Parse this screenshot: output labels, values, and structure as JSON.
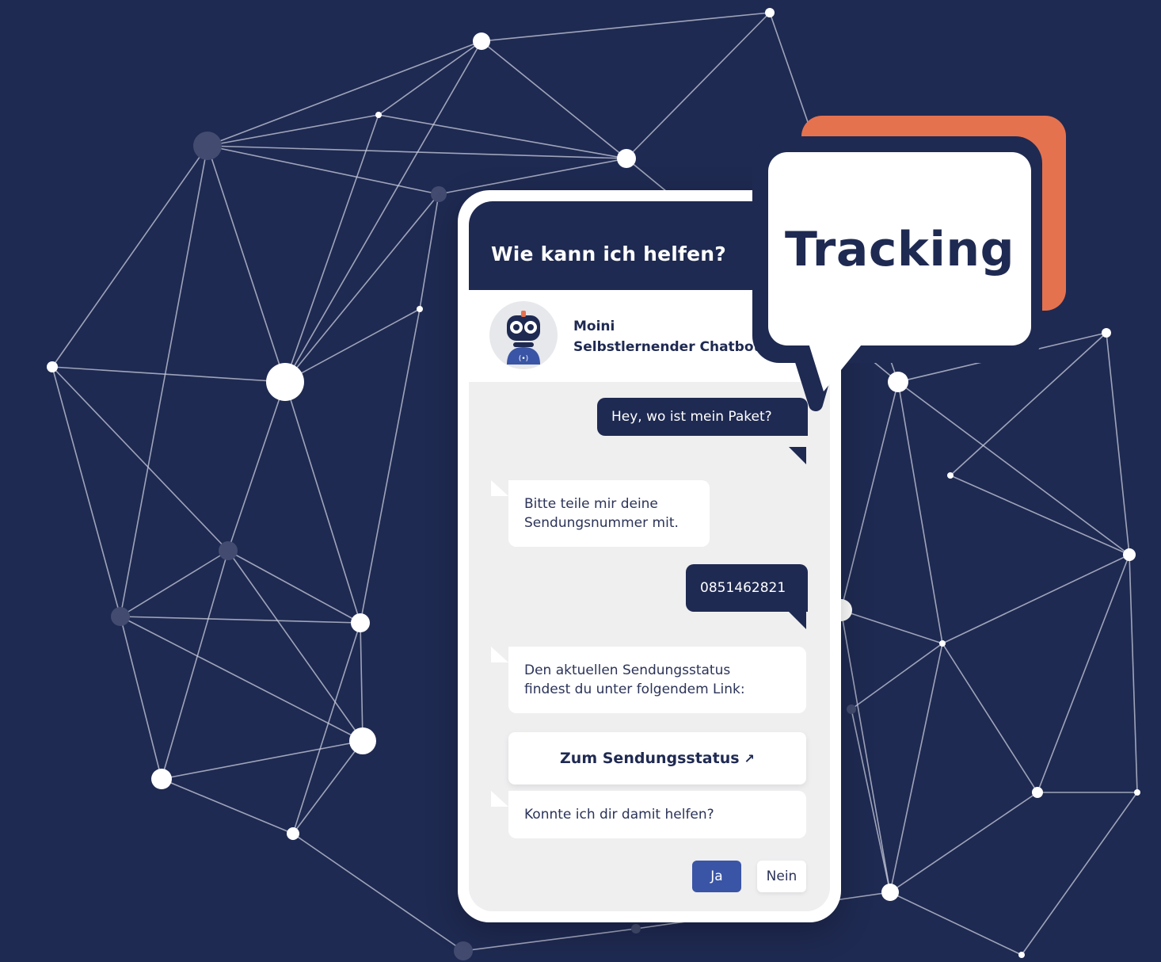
{
  "chat": {
    "title": "Wie kann ich helfen?",
    "bot_name": "Moini",
    "bot_subtitle": "Selbstlernender Chatbot",
    "messages": [
      {
        "from": "user",
        "text": "Hey, wo ist mein Paket?"
      },
      {
        "from": "bot",
        "text": "Bitte teile mir deine\nSendungsnummer mit."
      },
      {
        "from": "user",
        "text": "0851462821"
      },
      {
        "from": "bot",
        "text": "Den aktuellen Sendungsstatus\nfindest du unter folgendem Link:"
      },
      {
        "from": "bot",
        "text": "Konnte ich dir damit helfen?"
      }
    ],
    "link_button": {
      "label": "Zum Sendungsstatus",
      "icon": "arrow-up-right-icon",
      "glyph": "↗"
    },
    "quick_replies": {
      "yes": "Ja",
      "no": "Nein"
    }
  },
  "badge": {
    "label": "Tracking"
  },
  "colors": {
    "navy": "#1f2a52",
    "accent_orange": "#e5724f",
    "button_blue": "#3a55a6",
    "chat_background": "#efeff0"
  }
}
